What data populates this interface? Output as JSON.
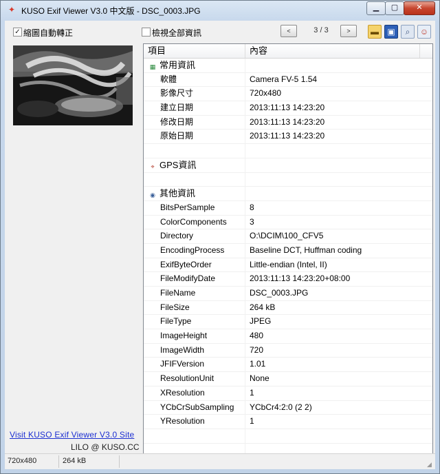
{
  "window": {
    "title": "KUSO Exif Viewer V3.0 中文版 - DSC_0003.JPG"
  },
  "toolbar": {
    "auto_rotate_label": "縮圖自動轉正",
    "auto_rotate_checked": true,
    "view_all_label": "檢視全部資訊",
    "view_all_checked": false,
    "prev_glyph": "<",
    "next_glyph": ">",
    "page_counter": "3 / 3"
  },
  "sidebar": {
    "site_link": "Visit KUSO Exif Viewer V3.0 Site",
    "credit": "LILO @ KUSO.CC"
  },
  "table": {
    "headers": {
      "item": "項目",
      "content": "內容"
    },
    "groups": [
      {
        "name": "常用資訊",
        "icon": "common-info-icon",
        "rows": [
          {
            "name": "軟體",
            "value": "Camera FV-5 1.54"
          },
          {
            "name": "影像尺寸",
            "value": "720x480"
          },
          {
            "name": "建立日期",
            "value": "2013:11:13 14:23:20"
          },
          {
            "name": "修改日期",
            "value": "2013:11:13 14:23:20"
          },
          {
            "name": "原始日期",
            "value": "2013:11:13 14:23:20"
          }
        ]
      },
      {
        "name": "GPS資訊",
        "icon": "gps-icon",
        "rows": []
      },
      {
        "name": "其他資訊",
        "icon": "camera-icon",
        "rows": [
          {
            "name": "BitsPerSample",
            "value": "8"
          },
          {
            "name": "ColorComponents",
            "value": "3"
          },
          {
            "name": "Directory",
            "value": "O:\\DCIM\\100_CFV5"
          },
          {
            "name": "EncodingProcess",
            "value": "Baseline DCT, Huffman coding"
          },
          {
            "name": "ExifByteOrder",
            "value": "Little-endian (Intel, II)"
          },
          {
            "name": "FileModifyDate",
            "value": "2013:11:13 14:23:20+08:00"
          },
          {
            "name": "FileName",
            "value": "DSC_0003.JPG"
          },
          {
            "name": "FileSize",
            "value": "264 kB"
          },
          {
            "name": "FileType",
            "value": "JPEG"
          },
          {
            "name": "ImageHeight",
            "value": "480"
          },
          {
            "name": "ImageWidth",
            "value": "720"
          },
          {
            "name": "JFIFVersion",
            "value": "1.01"
          },
          {
            "name": "ResolutionUnit",
            "value": "None"
          },
          {
            "name": "XResolution",
            "value": "1"
          },
          {
            "name": "YCbCrSubSampling",
            "value": "YCbCr4:2:0 (2 2)"
          },
          {
            "name": "YResolution",
            "value": "1"
          }
        ]
      }
    ]
  },
  "status": {
    "dimensions": "720x480",
    "size": "264 kB"
  },
  "colors": {
    "link": "#1c2fd1",
    "close_button": "#c7462f",
    "title_gradient": "#c7d8ec"
  }
}
